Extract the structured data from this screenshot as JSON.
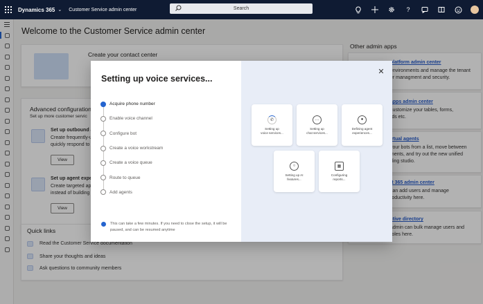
{
  "header": {
    "brand": "Dynamics 365",
    "app_name": "Customer Service admin center",
    "search_label": "Search"
  },
  "page": {
    "title": "Welcome to the Customer Service admin center",
    "contact_center_title": "Create your contact center",
    "advanced_title": "Advanced configuration",
    "advanced_sub": "Set up more customer servic",
    "outbound_title": "Set up outbound a",
    "outbound_l1": "Create frequently-u",
    "outbound_l2": "quickly respond to c",
    "view_label": "View",
    "agent_title": "Set up agent exper",
    "agent_l1": "Create targeted app",
    "agent_l2": "instead of building",
    "quick_links_title": "Quick links",
    "quick_links": [
      "Read the Customer Service documentation",
      "Share your thoughts and ideas",
      "Ask questions to community members"
    ],
    "other_apps_title": "Other admin apps",
    "other_apps": [
      {
        "title": "platform admin center",
        "l1": "environments and manage the tenant",
        "l2": "er managment and security."
      },
      {
        "title": "apps admin center",
        "l1": "customize your tables, forms,",
        "l2": "rds etc."
      },
      {
        "title": "irtual agents",
        "l1": "your bots from a list, move between",
        "l2": "ments, and try out the new unified",
        "l3": "ding studio."
      },
      {
        "title": "ft 365 admin center",
        "l1": "can add users and manage",
        "l2": "roductivity here."
      },
      {
        "title": "ctive directory",
        "l1": "admin can bulk manage users and",
        "l2": "roles here."
      }
    ]
  },
  "dialog": {
    "title": "Setting up voice services...",
    "steps": [
      "Acquire phone number",
      "Enable voice channel",
      "Configure bot",
      "Create a voice workstream",
      "Create a voice queue",
      "Route to queue",
      "Add agents"
    ],
    "info": "This can take a few minutes. If you need to close the setup, it will be paused, and can be resumed anytime",
    "tiles": [
      "Setting up\nvoice services...",
      "Setting up\nchat services...",
      "Defining agent\nexperiences...",
      "Setting up AI\nfeatures...",
      "Configuring\nreports..."
    ]
  }
}
